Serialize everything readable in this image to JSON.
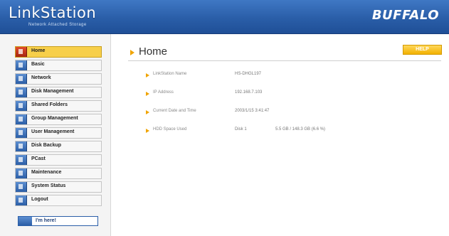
{
  "header": {
    "logo": "LinkStation",
    "logo_sub": "Network Attached Storage",
    "brand": "BUFFALO"
  },
  "sidebar": {
    "items": [
      {
        "label": "Home",
        "active": true
      },
      {
        "label": "Basic"
      },
      {
        "label": "Network"
      },
      {
        "label": "Disk Management"
      },
      {
        "label": "Shared Folders"
      },
      {
        "label": "Group Management"
      },
      {
        "label": "User Management"
      },
      {
        "label": "Disk Backup"
      },
      {
        "label": "PCast"
      },
      {
        "label": "Maintenance"
      },
      {
        "label": "System Status"
      },
      {
        "label": "Logout"
      }
    ],
    "here_label": "I'm here!"
  },
  "main": {
    "title": "Home",
    "help_label": "HELP",
    "info": [
      {
        "label": "LinkStation Name",
        "value": "HS-DHGL197"
      },
      {
        "label": "IP Address",
        "value": "192.168.7.103"
      },
      {
        "label": "Current Date and Time",
        "value": "2003/1/15 3:41:47"
      },
      {
        "label": "HDD Space Used",
        "value": "Disk 1",
        "extra": "5.5 GB / 148.3 GB (6.6 %)"
      }
    ]
  },
  "colors": {
    "header_blue": "#2a5ea8",
    "active_yellow": "#f7cf4a",
    "accent_orange": "#f0a400"
  }
}
